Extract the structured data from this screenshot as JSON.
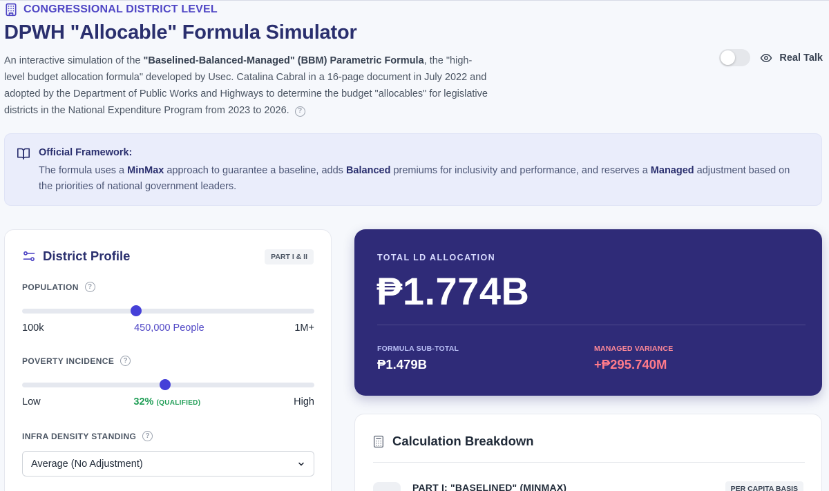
{
  "header": {
    "eyebrow": "CONGRESSIONAL DISTRICT LEVEL",
    "title": "DPWH \"Allocable\" Formula Simulator",
    "description": {
      "p1": "An interactive simulation of the ",
      "bold": "\"Baselined-Balanced-Managed\" (BBM) Parametric Formula",
      "p2": ", the \"high-level budget allocation formula\" developed by Usec. Catalina Cabral in a 16-page document in July 2022 and adopted by the Department of Public Works and Highways to determine the budget \"allocables\" for legislative districts in the National Expenditure Program from 2023 to 2026."
    },
    "real_talk": {
      "label": "Real Talk",
      "enabled": false
    }
  },
  "framework": {
    "title": "Official Framework:",
    "t1": "The formula uses a ",
    "b1": "MinMax",
    "t2": " approach to guarantee a baseline, adds ",
    "b2": "Balanced",
    "t3": " premiums for inclusivity and performance, and reserves a ",
    "b3": "Managed",
    "t4": " adjustment based on the priorities of national government leaders."
  },
  "profile": {
    "title": "District Profile",
    "badge": "PART I & II",
    "population": {
      "label": "POPULATION",
      "min": "100k",
      "value": "450,000 People",
      "max": "1M+",
      "fraction": 0.39
    },
    "poverty": {
      "label": "POVERTY INCIDENCE",
      "min": "Low",
      "value": "32%",
      "qualifier": "(QUALIFIED)",
      "max": "High",
      "fraction": 0.49
    },
    "infra": {
      "label": "INFRA DENSITY STANDING",
      "selected": "Average (No Adjustment)"
    }
  },
  "total": {
    "label": "TOTAL LD ALLOCATION",
    "value": "₱1.774B",
    "subtotal_label": "FORMULA SUB-TOTAL",
    "subtotal_value": "₱1.479B",
    "variance_label": "MANAGED VARIANCE",
    "variance_value": "+₱295.740M"
  },
  "breakdown": {
    "title": "Calculation Breakdown",
    "part1_title": "PART I: \"BASELINED\" (MINMAX)",
    "part1_badge": "PER CAPITA BASIS"
  },
  "colors": {
    "accent": "#4f46c5",
    "title": "#2a2f6e",
    "total_bg": "#2f2b78",
    "variance": "#ff7a8a",
    "qualified": "#1f9d55"
  }
}
